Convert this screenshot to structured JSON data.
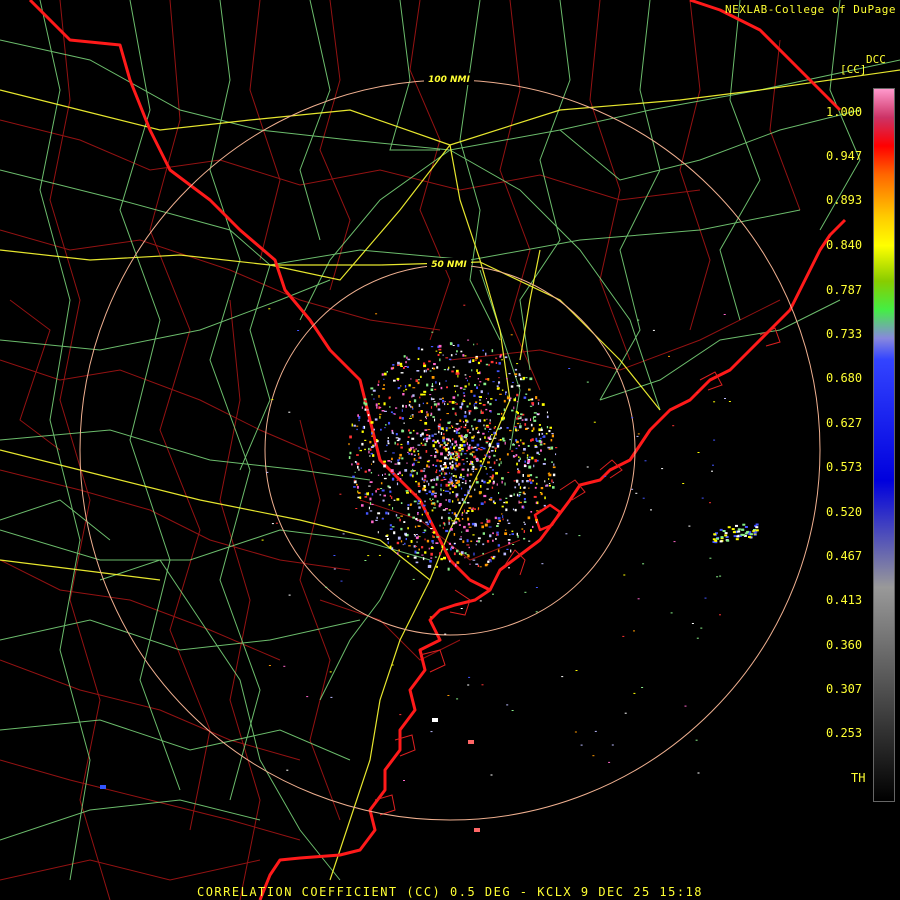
{
  "credit": "NEXLAB-College of DuPage",
  "legend": {
    "code": "DCC",
    "unit": "[CC]",
    "ticks": [
      "1.000",
      "0.947",
      "0.893",
      "0.840",
      "0.787",
      "0.733",
      "0.680",
      "0.627",
      "0.573",
      "0.520",
      "0.467",
      "0.413",
      "0.360",
      "0.307",
      "0.253",
      "TH"
    ]
  },
  "range_rings": [
    "100 NMI",
    "50 NMI"
  ],
  "footer": "CORRELATION COEFFICIENT (CC) 0.5 DEG - KCLX 9 DEC 25 15:18",
  "colors": {
    "state_border": "#ff1a1a",
    "county_line": "#b01818",
    "highway": "#ffff33",
    "road": "#88ee88",
    "ring": "#f0b090",
    "label": "#ffff33"
  },
  "colorbar_stops": [
    "#ff99cc",
    "#cc3366",
    "#ff0000",
    "#ff6600",
    "#ffcc00",
    "#ffff00",
    "#88cc00",
    "#44ee44",
    "#8888dd",
    "#3344ff",
    "#0000dd",
    "#999999",
    "#000000"
  ]
}
